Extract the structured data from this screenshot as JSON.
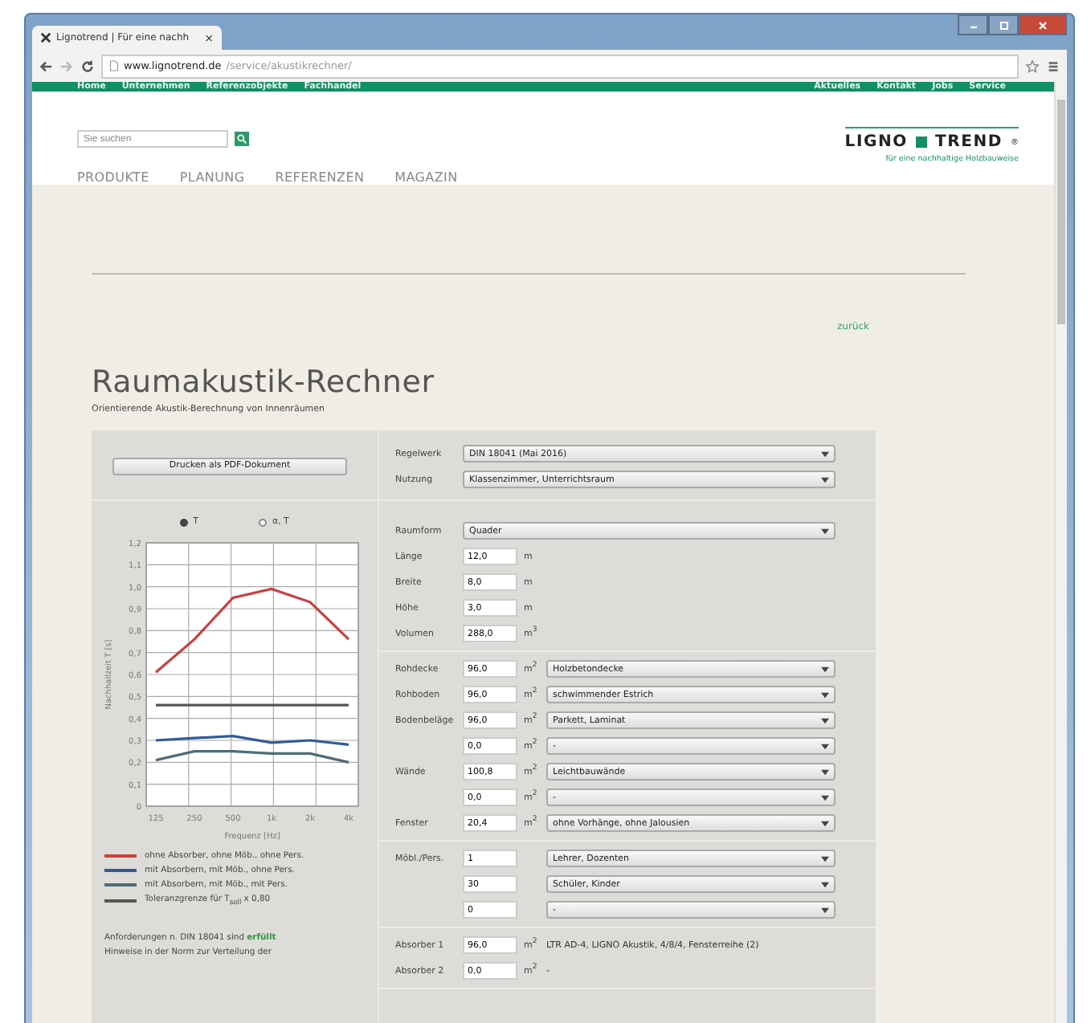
{
  "browser": {
    "tab_title": "Lignotrend | Für eine nachh",
    "tab_close": "×",
    "url_host": "www.lignotrend.de",
    "url_path": "/service/akustikrechner/"
  },
  "top_nav": {
    "left": [
      "Home",
      "Unternehmen",
      "Referenzobjekte",
      "Fachhandel"
    ],
    "right": [
      "Aktuelles",
      "Kontakt",
      "Jobs",
      "Service"
    ]
  },
  "search": {
    "placeholder": "Sie suchen"
  },
  "logo": {
    "left": "LIGNO",
    "right": "TREND",
    "mark": "®",
    "tagline": "für eine nachhaltige Holzbauweise"
  },
  "main_menu": [
    "PRODUKTE",
    "PLANUNG",
    "REFERENZEN",
    "MAGAZIN"
  ],
  "back_link": "zurück",
  "title": "Raumakustik-Rechner",
  "subtitle": "Orientierende Akustik-Berechnung von Innenräumen",
  "print_button": "Drucken als PDF-Dokument",
  "chart_options": [
    {
      "label": "T",
      "selected": true
    },
    {
      "label": "α, T",
      "selected": false
    }
  ],
  "chart_data": {
    "type": "line",
    "grid": true,
    "xlabel": "Frequenz [Hz]",
    "ylabel": "Nachhallzeit T [s]",
    "categories": [
      "125",
      "250",
      "500",
      "1k",
      "2k",
      "4k"
    ],
    "ylim": [
      0,
      1.2
    ],
    "yticks": [
      {
        "value": 0,
        "label": "0"
      },
      {
        "value": 0.1,
        "label": "0,1"
      },
      {
        "value": 0.2,
        "label": "0,2"
      },
      {
        "value": 0.3,
        "label": "0,3"
      },
      {
        "value": 0.4,
        "label": "0,4"
      },
      {
        "value": 0.5,
        "label": "0,5"
      },
      {
        "value": 0.6,
        "label": "0,6"
      },
      {
        "value": 0.7,
        "label": "0,7"
      },
      {
        "value": 0.8,
        "label": "0,8"
      },
      {
        "value": 0.9,
        "label": "0,9"
      },
      {
        "value": 1.0,
        "label": "1,0"
      },
      {
        "value": 1.1,
        "label": "1,1"
      },
      {
        "value": 1.2,
        "label": "1,2"
      }
    ],
    "series": [
      {
        "name": "ohne Absorber, ohne Möb., ohne Pers.",
        "color": "#c8413f",
        "values": [
          0.61,
          0.76,
          0.95,
          0.99,
          0.93,
          0.76
        ]
      },
      {
        "name": "mit Absorbern, mit Möb., ohne Pers.",
        "color": "#2f5b9a",
        "values": [
          0.3,
          0.31,
          0.32,
          0.29,
          0.3,
          0.28
        ]
      },
      {
        "name": "mit Absorbern, mit Möb., mit Pers.",
        "color": "#4d6d7a",
        "values": [
          0.21,
          0.25,
          0.25,
          0.24,
          0.24,
          0.2
        ]
      },
      {
        "name": "Toleranzgrenze für T$_{soll}$ x 0,80",
        "color": "#555555",
        "values": [
          0.46,
          0.46,
          0.46,
          0.46,
          0.46,
          0.46
        ]
      }
    ]
  },
  "result_text": "Anforderungen n. DIN 18041 sind ",
  "result_status": "erfüllt",
  "note_text": "Hinweise in der Norm zur Verteilung der",
  "form_groups": [
    {
      "rows": [
        {
          "kind": "select",
          "label": "Regelwerk",
          "select": "DIN 18041 (Mai 2016)"
        },
        {
          "kind": "select",
          "label": "Nutzung",
          "select": "Klassenzimmer, Unterrichtsraum"
        }
      ]
    },
    {
      "rows": [
        {
          "kind": "select",
          "label": "Raumform",
          "select": "Quader"
        },
        {
          "kind": "input",
          "label": "Länge",
          "value": "12,0",
          "unit": "m"
        },
        {
          "kind": "input",
          "label": "Breite",
          "value": "8,0",
          "unit": "m"
        },
        {
          "kind": "input",
          "label": "Höhe",
          "value": "3,0",
          "unit": "m"
        },
        {
          "kind": "input",
          "label": "Volumen",
          "value": "288,0",
          "unit": "m$^{3}$"
        }
      ]
    },
    {
      "rows": [
        {
          "kind": "input_select",
          "label": "Rohdecke",
          "value": "96,0",
          "unit": "m$^{2}$",
          "select": "Holzbetondecke"
        },
        {
          "kind": "input_select",
          "label": "Rohboden",
          "value": "96,0",
          "unit": "m$^{2}$",
          "select": "schwimmender Estrich"
        },
        {
          "kind": "input_select",
          "label": "Bodenbeläge",
          "value": "96,0",
          "unit": "m$^{2}$",
          "select": "Parkett, Laminat"
        },
        {
          "kind": "input_select",
          "value": "0,0",
          "unit": "m$^{2}$",
          "select": "-"
        },
        {
          "kind": "input_select",
          "label": "Wände",
          "value": "100,8",
          "unit": "m$^{2}$",
          "select": "Leichtbauwände"
        },
        {
          "kind": "input_select",
          "value": "0,0",
          "unit": "m$^{2}$",
          "select": "-"
        },
        {
          "kind": "input_select",
          "label": "Fenster",
          "value": "20,4",
          "unit": "m$^{2}$",
          "select": "ohne Vorhänge, ohne Jalousien"
        }
      ]
    },
    {
      "rows": [
        {
          "kind": "input_select",
          "label": "Möbl./Pers.",
          "value": "1",
          "select": "Lehrer, Dozenten"
        },
        {
          "kind": "input_select",
          "value": "30",
          "select": "Schüler, Kinder"
        },
        {
          "kind": "input_select",
          "value": "0",
          "select": "-"
        }
      ]
    },
    {
      "rows": [
        {
          "kind": "input_text",
          "label": "Absorber 1",
          "value": "96,0",
          "unit": "m$^{2}$",
          "text": "LTR AD-4, LIGNO Akustik, 4/8/4, Fensterreihe (2)"
        },
        {
          "kind": "input_text",
          "label": "Absorber 2",
          "value": "0,0",
          "unit": "m$^{2}$",
          "text": "-"
        }
      ]
    }
  ]
}
